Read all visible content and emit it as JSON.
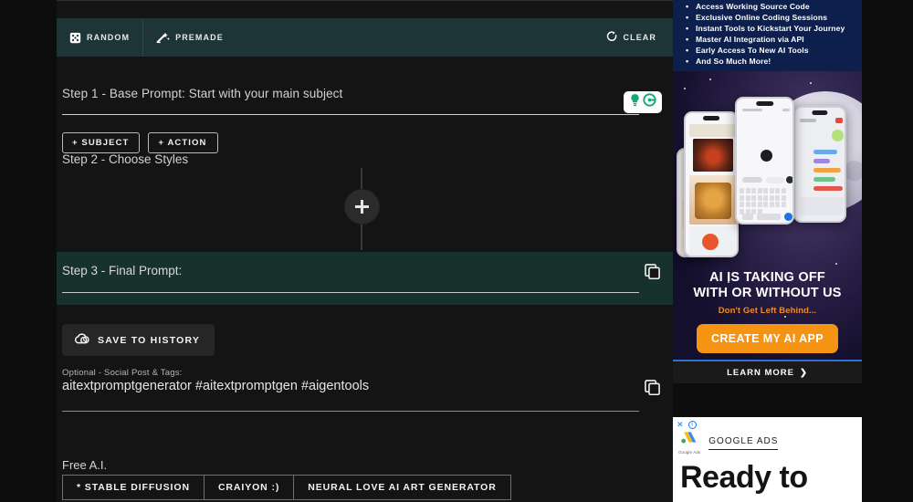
{
  "toolbar": {
    "random_label": "RANDOM",
    "premade_label": "PREMADE",
    "clear_label": "CLEAR",
    "bg_color": "#1e3537"
  },
  "step1": {
    "label": "Step 1 - Base Prompt: Start with your main subject",
    "subject_button": "+ SUBJECT",
    "action_button": "+ ACTION",
    "grammarly_accent": "#10a37f"
  },
  "step2": {
    "label": "Step 2 - Choose Styles",
    "add_button": "+"
  },
  "step3": {
    "label": "Step 3 - Final Prompt:",
    "bg_color": "#17322c",
    "save_button": "SAVE TO HISTORY"
  },
  "social": {
    "label": "Optional - Social Post & Tags:",
    "value": "aitextpromptgenerator #aitextpromptgen #aigentools"
  },
  "free_ai": {
    "label": "Free A.I.",
    "items": [
      {
        "label": "* STABLE DIFFUSION"
      },
      {
        "label": "CRAIYON :)"
      },
      {
        "label": "NEURAL LOVE AI ART GENERATOR"
      }
    ]
  },
  "ad": {
    "bg_color": "#0c1f4d",
    "bullets": [
      "Access Working Source Code",
      "Exclusive Online Coding Sessions",
      "Instant Tools to Kickstart Your Journey",
      "Master AI Integration via API",
      "Early Access To New AI Tools",
      "And So Much More!"
    ],
    "headline_line1": "AI IS TAKING OFF",
    "headline_line2": "WITH OR WITHOUT US",
    "subhead": "Don't Get Left Behind...",
    "cta_label": "CREATE MY AI APP",
    "cta_color": "#f59313",
    "learn_more_label": "LEARN MORE",
    "learn_more_chevron": "❯"
  },
  "google_ads": {
    "close_label": "✕",
    "info_label": "i",
    "logo_caption": "Google Ads",
    "title": "GOOGLE ADS",
    "headline": "Ready to"
  }
}
